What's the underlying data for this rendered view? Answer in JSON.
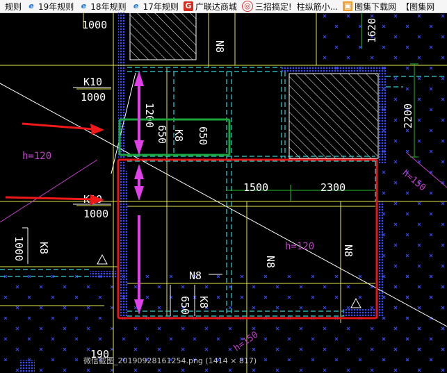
{
  "bookmarks": [
    {
      "label": "规则",
      "icon": "document-icon"
    },
    {
      "label": "19年规则",
      "icon": "ie-icon"
    },
    {
      "label": "18年规则",
      "icon": "ie-icon"
    },
    {
      "label": "17年规则",
      "icon": "ie-icon"
    },
    {
      "label": "广联达商城",
      "icon": "glodon-icon"
    },
    {
      "label": "三招搞定!",
      "icon": "circle-icon"
    },
    {
      "label": "柱纵筋小...",
      "icon": ""
    },
    {
      "label": "图集下载网",
      "icon": "image-icon"
    },
    {
      "label": "【图集网",
      "icon": ""
    }
  ],
  "drawing": {
    "dim_1000_a": "1000",
    "k10_a": "K10",
    "dim_1000_b": "1000",
    "dim_1200": "1200",
    "dim_650_a": "650",
    "k8_a": "K8",
    "dim_650_b": "650",
    "n8_top": "N8",
    "dim_1620": "1620",
    "dim_2200": "2200",
    "h120_a": "h=120",
    "h150_a": "h=150",
    "dim_1500": "1500",
    "dim_2300": "2300",
    "k10_b": "K10",
    "dim_1000_c": "1000",
    "dim_1000_d": "1000",
    "k8_b": "K8",
    "h120_b": "h=120",
    "n8_mid": "N8",
    "n8_right": "N8",
    "n8_bottom": "N8",
    "dim_650_c": "650",
    "k8_c": "K8",
    "dim_190": "190",
    "h150_b": "h=150"
  },
  "caption": "微信截图_20190928161254.png (1414 × 817)",
  "colors": {
    "highlight_red": "#e41818",
    "highlight_green": "#1aa53a",
    "arrow_magenta": "#e040e8",
    "arrow_red": "#f01818",
    "cad_cyan": "#30d6d6",
    "cad_yellow": "#e6e650",
    "cad_blue": "#3a4cf0",
    "cad_text": "#ffffff",
    "cad_magenta": "#c040c8"
  }
}
